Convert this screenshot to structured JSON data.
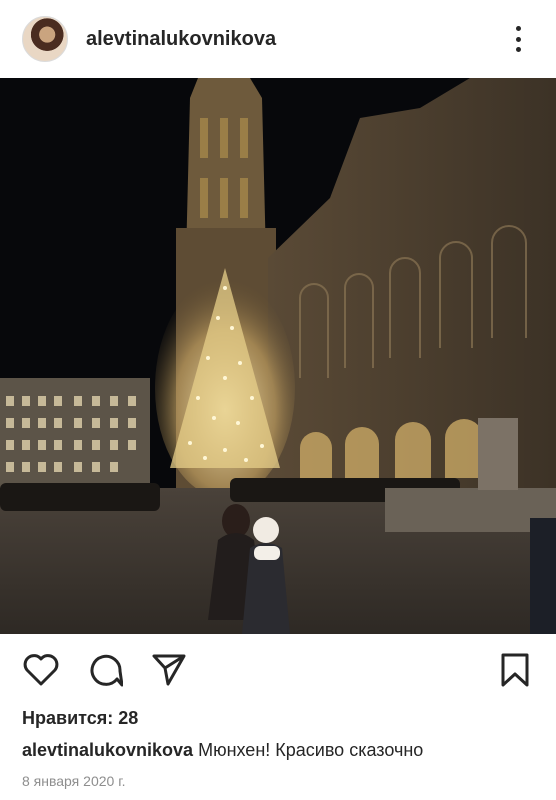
{
  "post": {
    "username": "alevtinalukovnikova",
    "likes_text": "Нравится: 28",
    "caption_user": "alevtinalukovnikova",
    "caption_text": " Мюнхен! Красиво сказочно",
    "date": "8 января 2020 г."
  },
  "icons": {
    "more": "more-vertical-icon",
    "like": "heart-icon",
    "comment": "comment-bubble-icon",
    "share": "send-paper-plane-icon",
    "save": "bookmark-icon"
  },
  "colors": {
    "text": "#262626",
    "muted": "#8e8e8e",
    "border": "#dbdbdb"
  }
}
